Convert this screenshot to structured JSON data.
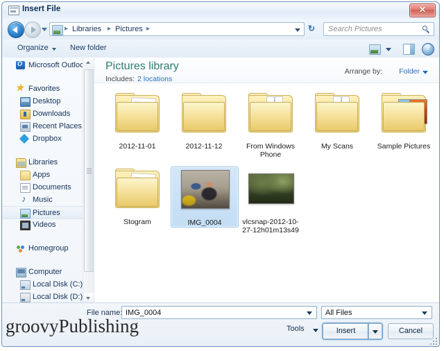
{
  "window": {
    "title": "Insert File",
    "title_icon": "window-icon",
    "close_label": "✕"
  },
  "nav": {
    "back_icon": "back-arrow-icon",
    "forward_icon": "forward-arrow-icon",
    "recent_icon": "recent-pages-dropdown-icon",
    "breadcrumbs": [
      "Libraries",
      "Pictures"
    ],
    "separator": "▸",
    "refresh_icon": "refresh-icon",
    "refresh_glyph": "↻"
  },
  "search": {
    "placeholder": "Search Pictures",
    "icon": "search-icon"
  },
  "commandbar": {
    "organize": "Organize",
    "new_folder": "New folder",
    "view_icon": "view-mode-icon",
    "preview_icon": "preview-pane-icon",
    "help_icon": "help-icon",
    "help_glyph": "?"
  },
  "sidebar": {
    "items": [
      {
        "label": "Microsoft Outlook",
        "icon": "outlook-icon",
        "level": "group",
        "selected": false
      },
      {
        "label": "Favorites",
        "icon": "star-icon",
        "level": "group",
        "selected": false
      },
      {
        "label": "Desktop",
        "icon": "desktop-icon",
        "level": "child",
        "selected": false
      },
      {
        "label": "Downloads",
        "icon": "downloads-icon",
        "level": "child",
        "selected": false
      },
      {
        "label": "Recent Places",
        "icon": "recent-places-icon",
        "level": "child",
        "selected": false
      },
      {
        "label": "Dropbox",
        "icon": "dropbox-icon",
        "level": "child",
        "selected": false
      },
      {
        "label": "Libraries",
        "icon": "libraries-icon",
        "level": "group",
        "selected": false
      },
      {
        "label": "Apps",
        "icon": "folder-icon",
        "level": "child",
        "selected": false
      },
      {
        "label": "Documents",
        "icon": "documents-icon",
        "level": "child",
        "selected": false
      },
      {
        "label": "Music",
        "icon": "music-icon",
        "level": "child",
        "selected": false
      },
      {
        "label": "Pictures",
        "icon": "pictures-icon",
        "level": "child",
        "selected": true
      },
      {
        "label": "Videos",
        "icon": "videos-icon",
        "level": "child",
        "selected": false
      },
      {
        "label": "Homegroup",
        "icon": "homegroup-icon",
        "level": "group",
        "selected": false
      },
      {
        "label": "Computer",
        "icon": "computer-icon",
        "level": "group",
        "selected": false
      },
      {
        "label": "Local Disk (C:)",
        "icon": "drive-icon",
        "level": "child",
        "selected": false
      },
      {
        "label": "Local Disk (D:)",
        "icon": "drive-icon-gray",
        "level": "child",
        "selected": false
      }
    ],
    "scrollbar": {
      "up_icon": "scroll-up-icon",
      "down_icon": "scroll-down-icon"
    }
  },
  "library": {
    "title": "Pictures library",
    "includes_label": "Includes:",
    "includes_link": "2 locations",
    "arrange_label": "Arrange by:",
    "arrange_value": "Folder"
  },
  "files": [
    {
      "name": "2012-11-01",
      "kind": "folder",
      "variant": "paper",
      "selected": false
    },
    {
      "name": "2012-11-12",
      "kind": "folder",
      "variant": "plain",
      "selected": false
    },
    {
      "name": "From Windows Phone",
      "kind": "folder",
      "variant": "sheets",
      "selected": false
    },
    {
      "name": "My Scans",
      "kind": "folder",
      "variant": "sheets",
      "selected": false
    },
    {
      "name": "Sample Pictures",
      "kind": "folder",
      "variant": "photos",
      "selected": false
    },
    {
      "name": "Stogram",
      "kind": "folder",
      "variant": "paper",
      "selected": false
    },
    {
      "name": "IMG_0004",
      "kind": "image",
      "variant": "photo-street",
      "selected": true
    },
    {
      "name": "vlcsnap-2012-10-27-12h01m13s49",
      "kind": "image",
      "variant": "photo-forest",
      "selected": false
    }
  ],
  "bottom": {
    "filename_label": "File name:",
    "filename_value": "IMG_0004",
    "filter_value": "All Files",
    "tools_label": "Tools",
    "insert_label": "Insert",
    "cancel_label": "Cancel"
  },
  "watermark": "groovyPublishing",
  "colors": {
    "accent_blue": "#2a6fb5",
    "library_title_green": "#2d7d6e",
    "selection_blue": "#c3ddf4",
    "close_red": "#cf6258"
  }
}
